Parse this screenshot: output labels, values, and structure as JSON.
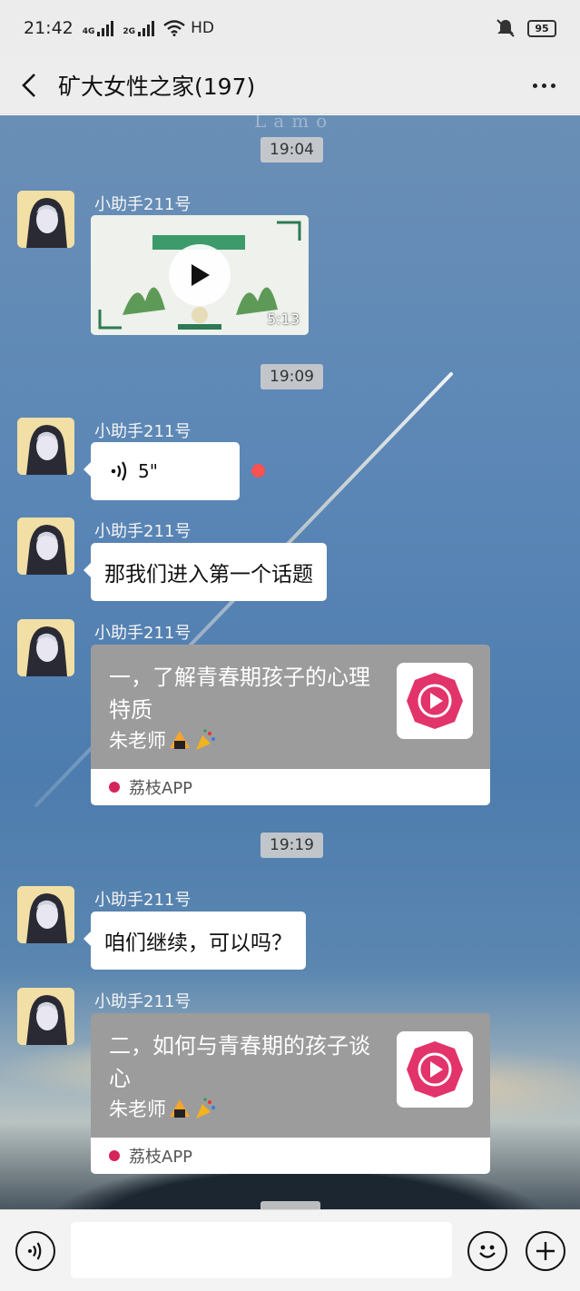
{
  "status_bar": {
    "time": "21:42",
    "net1": "4G",
    "net2": "2G",
    "wifi_label": "HD",
    "battery": "95"
  },
  "header": {
    "title": "矿大女性之家(197)"
  },
  "background": {
    "watermark": "Lamo"
  },
  "messages": [
    {
      "type": "time",
      "text": "19:04"
    },
    {
      "type": "video",
      "sender": "小助手211号",
      "duration": "5:13"
    },
    {
      "type": "time",
      "text": "19:09"
    },
    {
      "type": "voice",
      "sender": "小助手211号",
      "length": "5\"",
      "unread": true
    },
    {
      "type": "text",
      "sender": "小助手211号",
      "text": "那我们进入第一个话题"
    },
    {
      "type": "link",
      "sender": "小助手211号",
      "title": "一，了解青春期孩子的心理特质",
      "desc": "朱老师",
      "source": "荔枝APP"
    },
    {
      "type": "time",
      "text": "19:19"
    },
    {
      "type": "text",
      "sender": "小助手211号",
      "text": "咱们继续，可以吗？"
    },
    {
      "type": "link",
      "sender": "小助手211号",
      "title": "二，如何与青春期的孩子谈心",
      "desc": "朱老师",
      "source": "荔枝APP"
    }
  ],
  "input_bar": {
    "placeholder": ""
  },
  "icons": {
    "back": "chevron-left-icon",
    "more": "more-dots-icon",
    "voice": "voice-icon",
    "emoji": "smiley-icon",
    "plus": "plus-icon",
    "play": "play-icon"
  },
  "colors": {
    "bubble": "#ffffff",
    "card": "#9c9c9c",
    "unread": "#fa5151",
    "brand_lizhi": "#d6245a"
  }
}
